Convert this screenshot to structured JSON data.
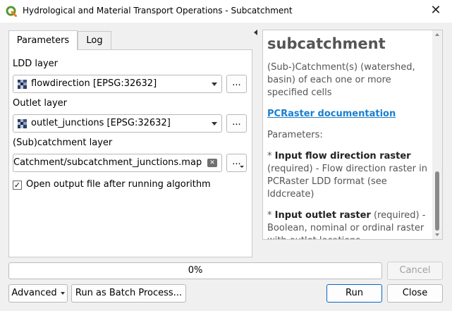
{
  "window": {
    "title": "Hydrological and Material Transport Operations - Subcatchment",
    "close_glyph": "✕"
  },
  "tabs": [
    {
      "label": "Parameters",
      "active": true
    },
    {
      "label": "Log",
      "active": false
    }
  ],
  "params": {
    "ldd_label": "LDD layer",
    "ldd_value": "flowdirection [EPSG:32632]",
    "outlet_label": "Outlet layer",
    "outlet_value": "outlet_junctions [EPSG:32632]",
    "subcatchment_label": "(Sub)catchment layer",
    "subcatchment_value": "Catchment/subcatchment_junctions.map",
    "browse_label": "...",
    "open_output_label": "Open output file after running algorithm",
    "open_output_checked": true
  },
  "help": {
    "title": "subcatchment",
    "description": "(Sub-)Catchment(s) (watershed, basin) of each one or more specified cells",
    "link": "PCRaster documentation",
    "parameters_heading": "Parameters:",
    "param1_name": "Input flow direction raster",
    "param1_desc": "(required) - Flow direction raster in PCRaster LDD format (see lddcreate)",
    "param2_name": "Input outlet raster",
    "param2_desc": "(required) - Boolean, nominal or ordinal raster with outlet locations"
  },
  "progress": {
    "text": "0%",
    "value": 0
  },
  "buttons": {
    "cancel": "Cancel",
    "advanced": "Advanced",
    "batch": "Run as Batch Process...",
    "run": "Run",
    "close": "Close"
  },
  "colors": {
    "accent": "#0a64c8",
    "link": "#1a7fcf",
    "qgis_green": "#589632"
  }
}
